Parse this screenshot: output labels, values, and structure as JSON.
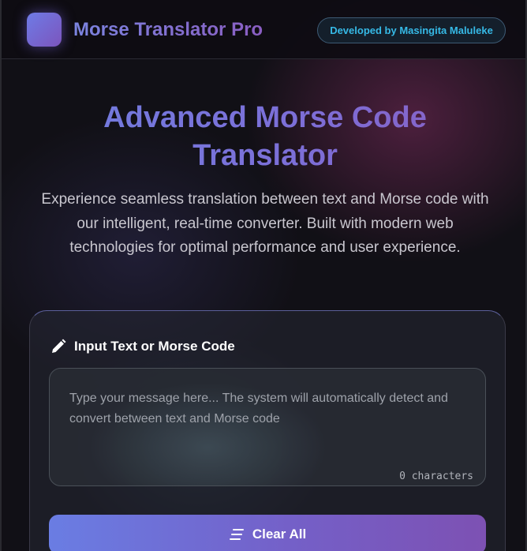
{
  "header": {
    "app_title": "Morse Translator Pro",
    "developer_badge": "Developed by Masingita Maluleke",
    "logo_icon": "app-logo-square"
  },
  "hero": {
    "title_line1": "Advanced Morse Code",
    "title_line2": "Translator",
    "description": "Experience seamless translation between text and Morse code with our intelligent, real-time converter. Built with modern web technologies for optimal performance and user experience."
  },
  "input_card": {
    "label": "Input Text or Morse Code",
    "label_icon": "pencil-icon",
    "input_value": "",
    "input_placeholder": "Type your message here... The system will automatically detect and convert between text and Morse code",
    "char_count": "0 characters"
  },
  "actions": {
    "clear_label": "Clear All",
    "clear_icon": "lines-icon"
  },
  "colors": {
    "accent_start": "#6e7be6",
    "accent_end": "#7c55bd",
    "badge_text": "#36b9e6",
    "background": "#111016"
  }
}
